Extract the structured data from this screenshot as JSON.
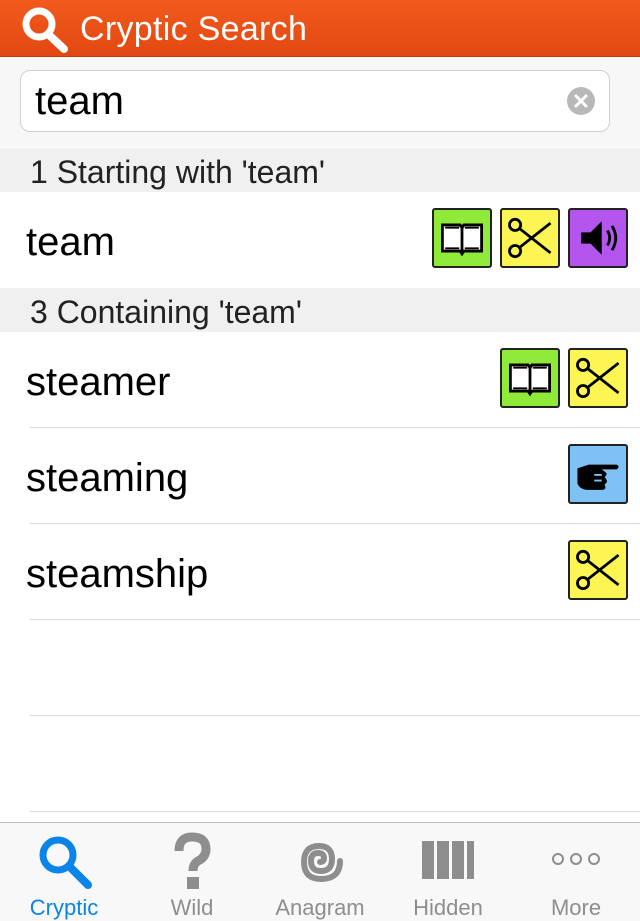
{
  "header": {
    "title": "Cryptic Search"
  },
  "search": {
    "value": "team"
  },
  "sections": [
    {
      "header": "1 Starting with  'team'",
      "rows": [
        {
          "word": "team",
          "badges": [
            "book",
            "scissors",
            "speaker"
          ]
        }
      ]
    },
    {
      "header": "3 Containing 'team'",
      "rows": [
        {
          "word": "steamer",
          "badges": [
            "book",
            "scissors"
          ]
        },
        {
          "word": "steaming",
          "badges": [
            "pointing-hand"
          ]
        },
        {
          "word": "steamship",
          "badges": [
            "scissors"
          ]
        }
      ]
    }
  ],
  "tabs": [
    {
      "label": "Cryptic",
      "icon": "search-icon",
      "active": true
    },
    {
      "label": "Wild",
      "icon": "question-icon",
      "active": false
    },
    {
      "label": "Anagram",
      "icon": "spiral-icon",
      "active": false
    },
    {
      "label": "Hidden",
      "icon": "columns-icon",
      "active": false
    },
    {
      "label": "More",
      "icon": "more-icon",
      "active": false
    }
  ],
  "colors": {
    "header": "#e8501a",
    "book_badge": "#8fea3a",
    "scissors_badge": "#fcf553",
    "speaker_badge": "#b455ee",
    "hand_badge": "#7ec2f5",
    "active_tab": "#0a84e8"
  }
}
